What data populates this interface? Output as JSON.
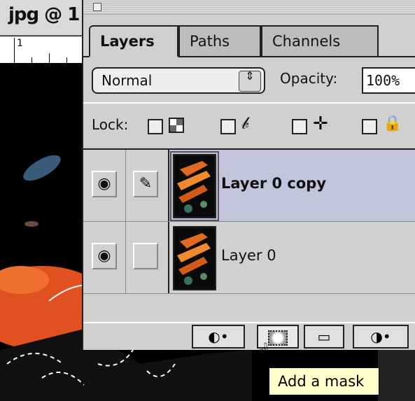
{
  "document": {
    "title": "jpg @ 1",
    "ruler_number": "1"
  },
  "layers_palette": {
    "tabs": [
      {
        "label": "Layers",
        "active": true
      },
      {
        "label": "Paths",
        "active": false
      },
      {
        "label": "Channels",
        "active": false
      }
    ],
    "blend_mode": {
      "value": "Normal",
      "arrows": "⇕"
    },
    "opacity": {
      "label": "Opacity:",
      "value": "100%"
    },
    "lock": {
      "label": "Lock:",
      "icons": [
        "transparency-icon",
        "brush-icon",
        "move-icon",
        "lock-icon"
      ]
    },
    "layers": [
      {
        "name": "Layer 0 copy",
        "visible": true,
        "selected": true,
        "brush": true
      },
      {
        "name": "Layer 0",
        "visible": true,
        "selected": false,
        "brush": false
      }
    ],
    "bottom_buttons": [
      {
        "name": "layer-styles-button",
        "glyph": "◐•"
      },
      {
        "name": "add-mask-button",
        "glyph": ""
      },
      {
        "name": "new-layer-set-button",
        "glyph": "▭"
      },
      {
        "name": "adjustment-layer-button",
        "glyph": "◑•"
      }
    ],
    "tooltip": "Add a mask"
  },
  "colors": {
    "palette_bg": "#d0d0d0",
    "selected_row": "#c3c3dc",
    "tooltip_bg": "#ffffcc"
  }
}
